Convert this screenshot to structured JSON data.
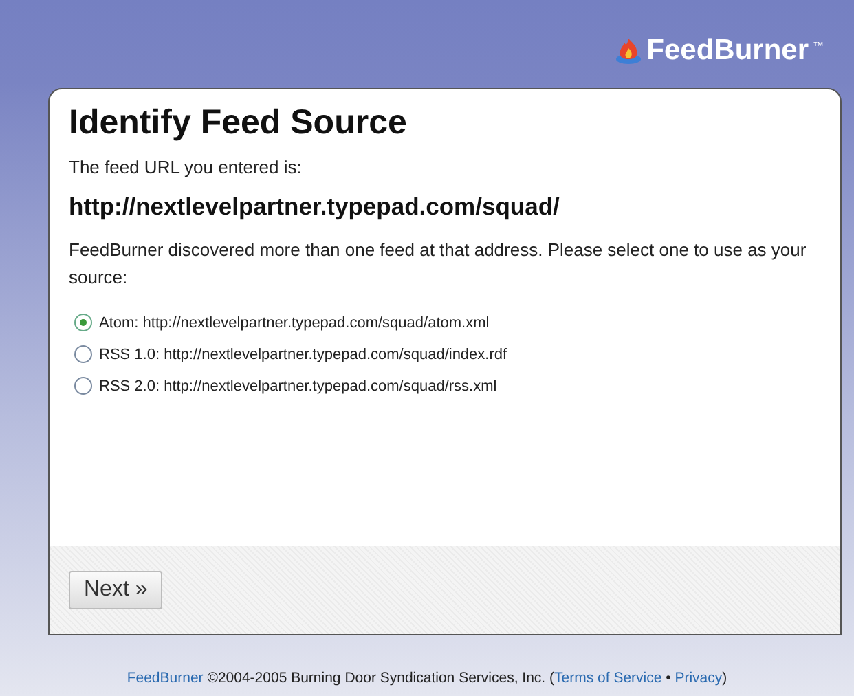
{
  "header": {
    "logo": "FeedBurner",
    "trademark": "™"
  },
  "card": {
    "title": "Identify Feed Source",
    "intro": "The feed URL you entered is:",
    "url": "http://nextlevelpartner.typepad.com/squad/",
    "message": "FeedBurner discovered more than one feed at that address. Please select one to use as your source:",
    "options": [
      {
        "label": "Atom: http://nextlevelpartner.typepad.com/squad/atom.xml",
        "selected": true
      },
      {
        "label": "RSS 1.0: http://nextlevelpartner.typepad.com/squad/index.rdf",
        "selected": false
      },
      {
        "label": "RSS 2.0: http://nextlevelpartner.typepad.com/squad/rss.xml",
        "selected": false
      }
    ],
    "button": "Next »"
  },
  "footer": {
    "brand_link": "FeedBurner",
    "text": " ©2004-2005 Burning Door Syndication Services, Inc. (",
    "terms_link": "Terms of Service",
    "separator": " • ",
    "privacy_link": "Privacy",
    "close": ")"
  }
}
